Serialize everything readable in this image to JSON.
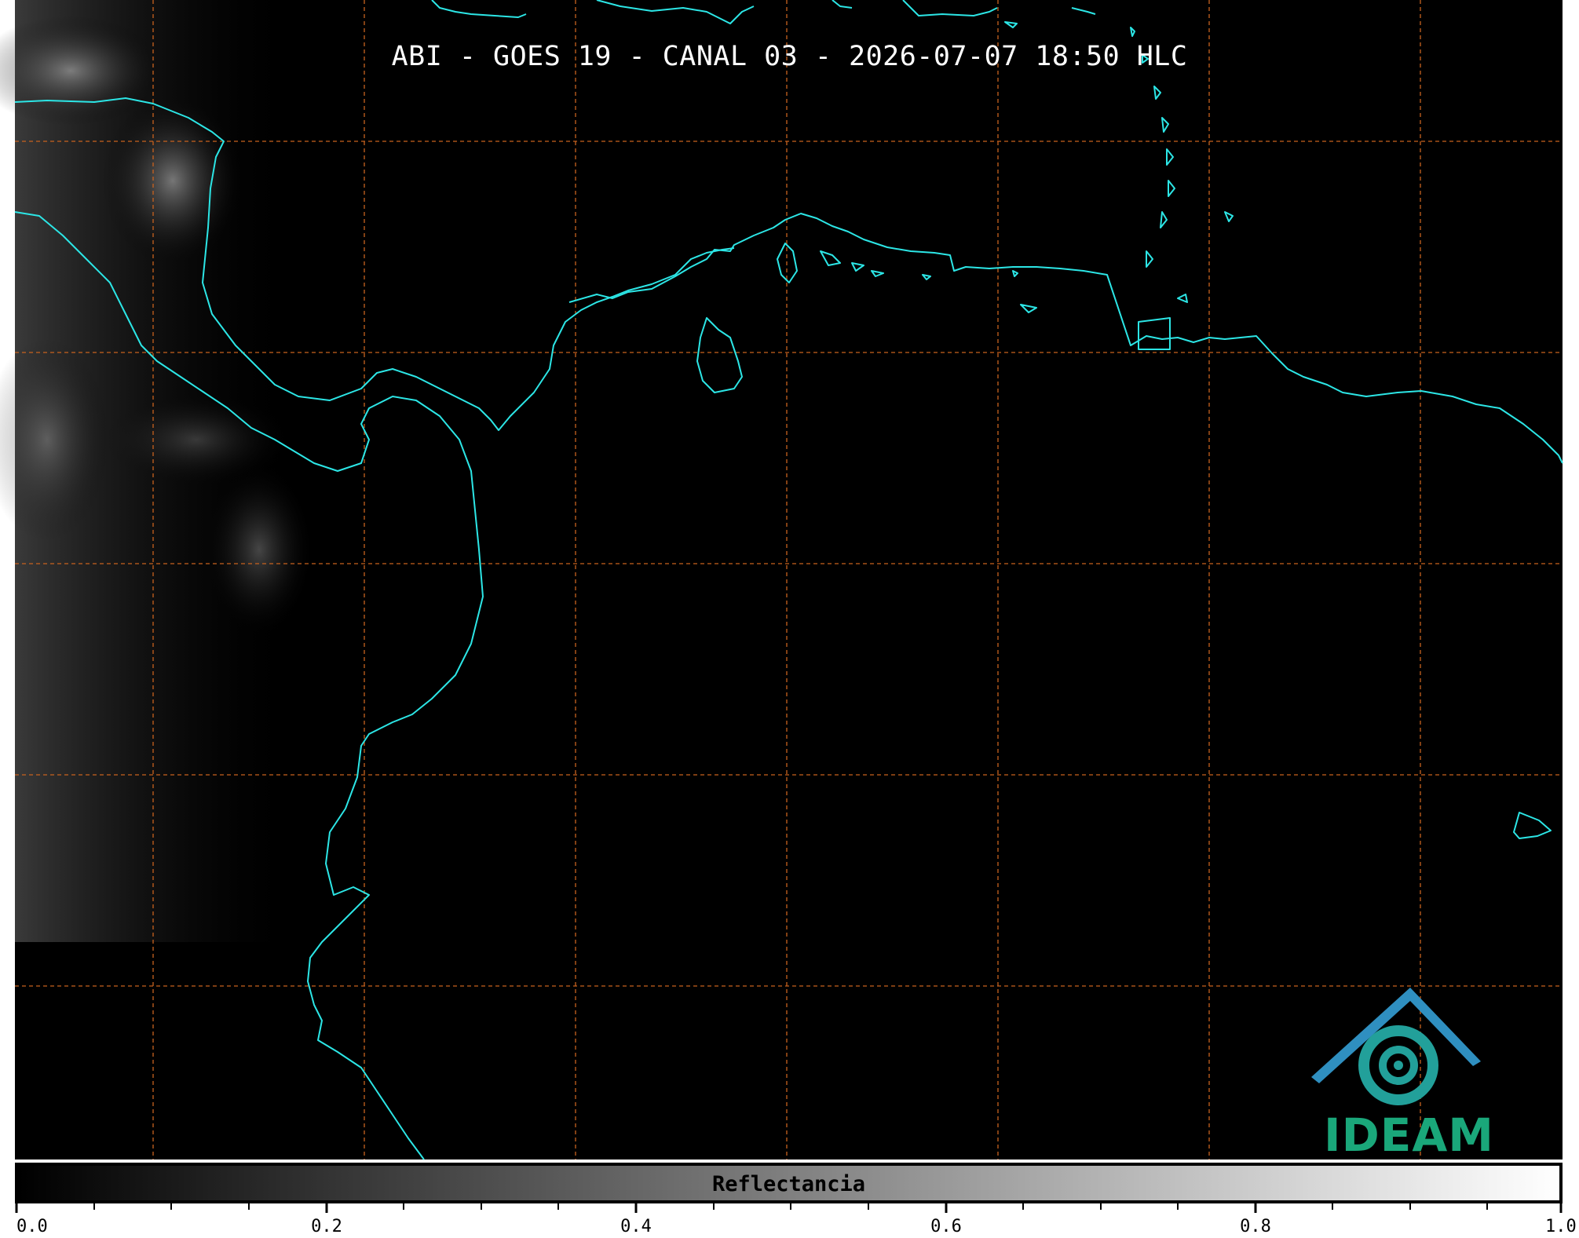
{
  "title": "ABI - GOES 19 - CANAL 03 - 2026-07-07 18:50 HLC",
  "colors": {
    "background": "#000000",
    "coastline": "#2ce6e6",
    "gridline": "#c8621e",
    "logo": "#1aa77a"
  },
  "icons": {
    "logo": "ideam-logo-icon"
  },
  "logo": {
    "text": "IDEAM"
  },
  "colorbar": {
    "label": "Reflectancia",
    "min": 0.0,
    "max": 1.0,
    "ticks": [
      "0.0",
      "0.2",
      "0.4",
      "0.6",
      "0.8",
      "1.0"
    ],
    "colormap": "grayscale black-to-white"
  }
}
